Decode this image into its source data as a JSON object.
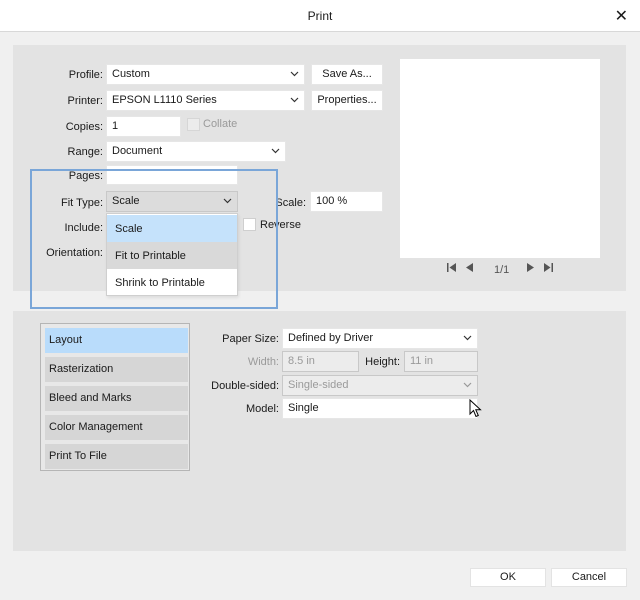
{
  "window": {
    "title": "Print",
    "close_glyph": "✕"
  },
  "form": {
    "profile_label": "Profile:",
    "profile_value": "Custom",
    "save_as": "Save As...",
    "printer_label": "Printer:",
    "printer_value": "EPSON L1110 Series",
    "properties": "Properties...",
    "copies_label": "Copies:",
    "copies_value": "1",
    "collate_label": "Collate",
    "range_label": "Range:",
    "range_value": "Document",
    "pages_label": "Pages:",
    "pages_value": "",
    "fit_type_label": "Fit Type:",
    "fit_type_value": "Scale",
    "scale_label": "Scale:",
    "scale_value": "100 %",
    "include_label": "Include:",
    "reverse_label": "Reverse",
    "orientation_label": "Orientation:"
  },
  "fit_type_dropdown": {
    "options": [
      "Scale",
      "Fit to Printable",
      "Shrink to Printable"
    ],
    "selected": "Scale",
    "hovered": "Fit to Printable"
  },
  "preview": {
    "page_indicator": "1/1"
  },
  "categories": [
    {
      "label": "Layout",
      "active": true
    },
    {
      "label": "Rasterization",
      "active": false
    },
    {
      "label": "Bleed and Marks",
      "active": false
    },
    {
      "label": "Color Management",
      "active": false
    },
    {
      "label": "Print To File",
      "active": false
    }
  ],
  "layout": {
    "paper_size_label": "Paper Size:",
    "paper_size_value": "Defined by Driver",
    "width_label": "Width:",
    "width_value": "8.5 in",
    "height_label": "Height:",
    "height_value": "11 in",
    "double_sided_label": "Double-sided:",
    "double_sided_value": "Single-sided",
    "model_label": "Model:",
    "model_value": "Single"
  },
  "footer": {
    "ok": "OK",
    "cancel": "Cancel"
  },
  "colors": {
    "accent_highlight": "#7aa6d8",
    "selected_item": "#c5e2fb",
    "active_category": "#b9dcfb"
  },
  "icons": [
    "close-icon",
    "chevron-down-icon",
    "first-page-icon",
    "prev-page-icon",
    "next-page-icon",
    "last-page-icon",
    "mouse-cursor-icon"
  ]
}
